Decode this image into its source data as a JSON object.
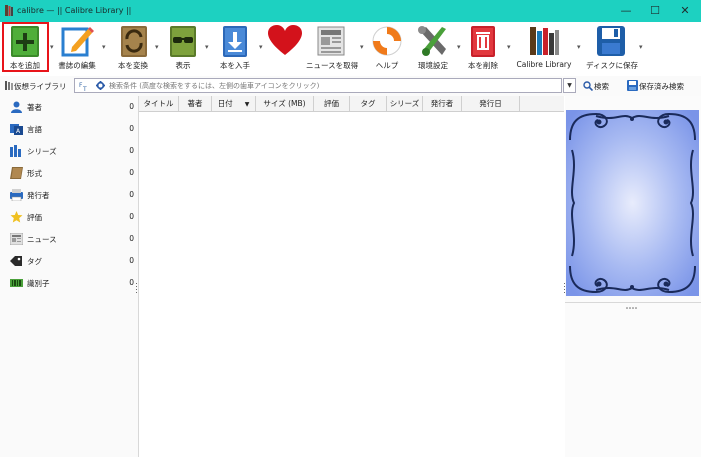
{
  "window": {
    "title": "calibre — || Calibre Library ||",
    "controls": {
      "minimize": "—",
      "maximize": "☐",
      "close": "✕"
    }
  },
  "toolbar": {
    "add_book": "本を追加",
    "edit_metadata": "書誌の編集",
    "convert": "本を変換",
    "view": "表示",
    "get_books": "本を入手",
    "fetch_news": "ニュースを取得",
    "help": "ヘルプ",
    "preferences": "環境設定",
    "remove": "本を削除",
    "library": "Calibre Library",
    "save_to_disk": "ディスクに保存"
  },
  "searchbar": {
    "virtual_library": "仮想ライブラリ",
    "placeholder": "検索条件 (高度な検索をするには、左側の歯車アイコンをクリック)",
    "search_label": "検索",
    "saved_searches": "保存済み検索"
  },
  "tag_browser": {
    "categories": [
      {
        "label": "著者",
        "count": "0"
      },
      {
        "label": "言語",
        "count": "0"
      },
      {
        "label": "シリーズ",
        "count": "0"
      },
      {
        "label": "形式",
        "count": "0"
      },
      {
        "label": "発行者",
        "count": "0"
      },
      {
        "label": "評価",
        "count": "0"
      },
      {
        "label": "ニュース",
        "count": "0"
      },
      {
        "label": "タグ",
        "count": "0"
      },
      {
        "label": "識別子",
        "count": "0"
      }
    ]
  },
  "book_list": {
    "columns": [
      "タイトル",
      "著者",
      "日付",
      "サイズ (MB)",
      "評価",
      "タグ",
      "シリーズ",
      "発行者",
      "発行日"
    ]
  },
  "colors": {
    "titlebar": "#1dd1c1",
    "highlight": "#e8141a",
    "cover_blue": "#8da4ee"
  }
}
